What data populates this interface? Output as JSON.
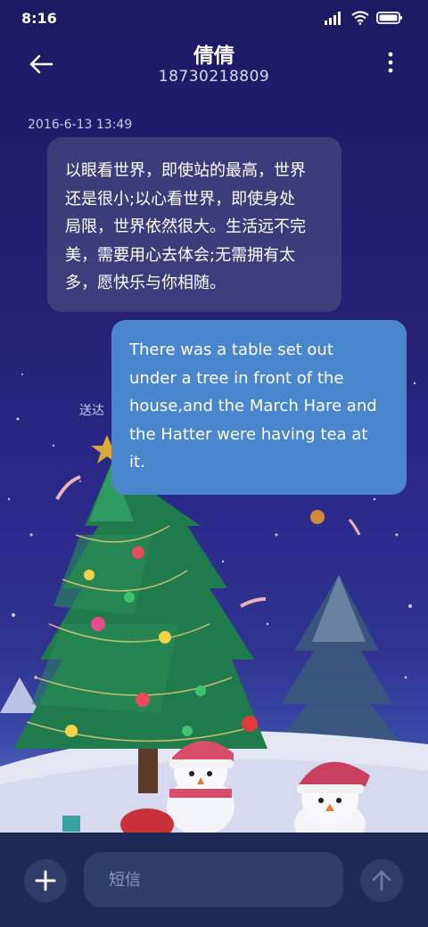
{
  "status_bar": {
    "time": "8:16",
    "icons": [
      "signal-icon",
      "wifi-icon",
      "battery-icon"
    ]
  },
  "header": {
    "contact_name": "倩倩",
    "contact_number": "18730218809",
    "back_icon": "back-arrow-icon",
    "menu_icon": "more-vert-icon"
  },
  "conversation": {
    "timestamp": "2016-6-13 13:49",
    "messages": [
      {
        "direction": "incoming",
        "lines": [
          "以眼看世界，即使站的最高，世界",
          "还是很小;以心看世界，即使身处",
          "局限，世界依然很大。生活远不完",
          "美，需要用心去体会;无需拥有太",
          "多，愿快乐与你相随。"
        ]
      },
      {
        "direction": "outgoing",
        "lines": [
          "There was a table set out",
          "under a tree in front of the",
          "house,and the March Hare and",
          "the Hatter were having tea at",
          "it."
        ]
      }
    ],
    "delivery_status": "送达"
  },
  "composer": {
    "add_icon": "plus-icon",
    "placeholder": "短信",
    "value": "",
    "send_icon": "send-arrow-icon"
  },
  "colors": {
    "outgoing_bubble": "#4a86cc",
    "incoming_bubble": "#484880",
    "bottom_bar": "#1d2a55"
  }
}
